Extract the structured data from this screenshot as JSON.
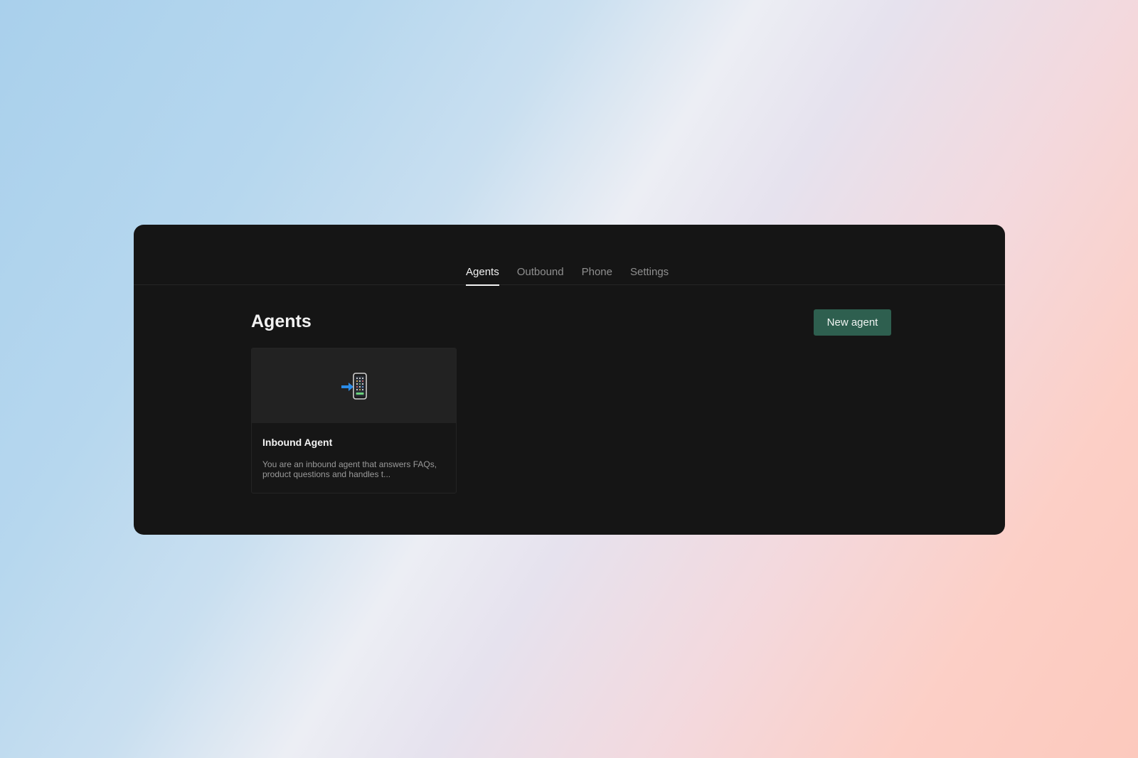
{
  "nav": {
    "tabs": [
      {
        "label": "Agents",
        "active": true
      },
      {
        "label": "Outbound",
        "active": false
      },
      {
        "label": "Phone",
        "active": false
      },
      {
        "label": "Settings",
        "active": false
      }
    ]
  },
  "main": {
    "title": "Agents",
    "new_agent_label": "New agent",
    "accent_color": "#2e5f4f",
    "agents": [
      {
        "icon": "mobile-phone-with-arrow-icon",
        "name": "Inbound Agent",
        "description": "You are an inbound agent that answers FAQs, product questions and handles t..."
      }
    ]
  }
}
